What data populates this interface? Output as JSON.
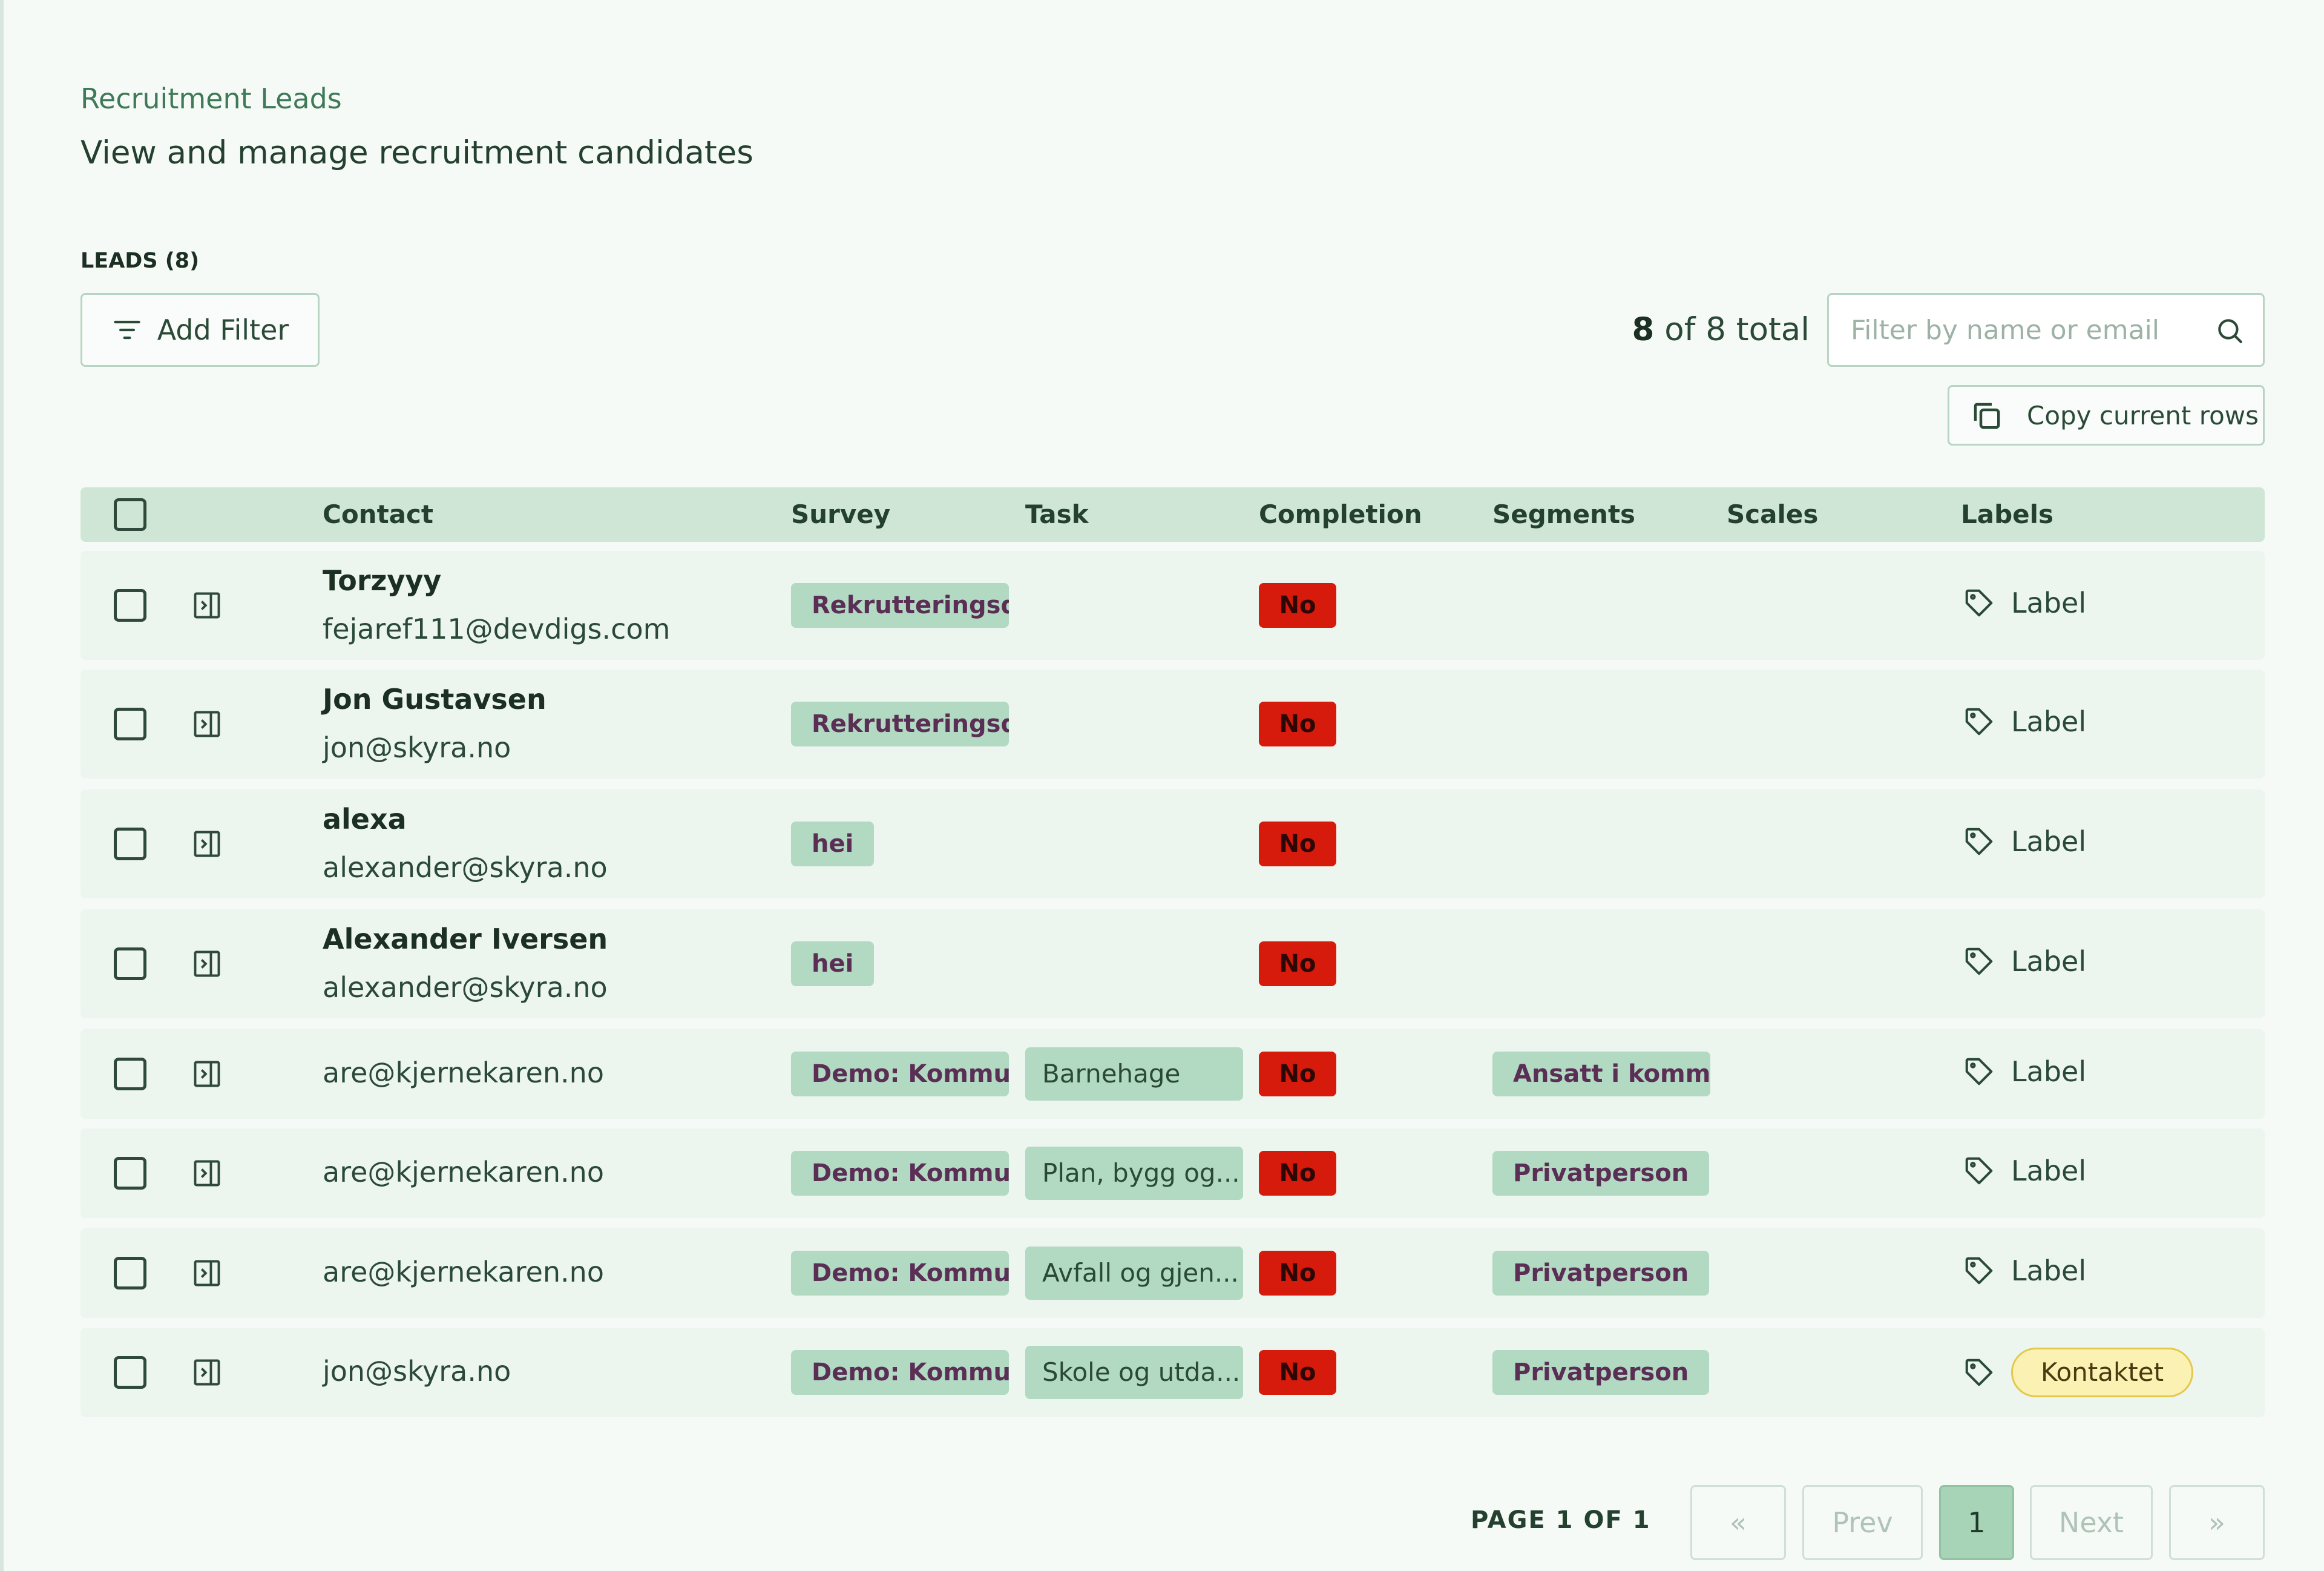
{
  "header": {
    "breadcrumb": "Recruitment Leads",
    "subtitle": "View and manage recruitment candidates"
  },
  "leads": {
    "heading": "LEADS (8)",
    "add_filter_label": "Add Filter",
    "total_count": "8",
    "total_suffix": "of 8 total",
    "search_placeholder": "Filter by name or email",
    "copy_label": "Copy current rows"
  },
  "table": {
    "columns": [
      "Contact",
      "Survey",
      "Task",
      "Completion",
      "Segments",
      "Scales",
      "Labels"
    ],
    "rows": [
      {
        "name": "Torzyyy",
        "email": "fejaref111@devdigs.com",
        "survey": "Rekrutteringsdesk",
        "task": "",
        "completion": "No",
        "segment": "",
        "label": "Label"
      },
      {
        "name": "Jon Gustavsen",
        "email": "jon@skyra.no",
        "survey": "Rekrutteringsdesk",
        "task": "",
        "completion": "No",
        "segment": "",
        "label": "Label"
      },
      {
        "name": "alexa",
        "email": "alexander@skyra.no",
        "survey": "hei",
        "task": "",
        "completion": "No",
        "segment": "",
        "label": "Label"
      },
      {
        "name": "Alexander Iversen",
        "email": "alexander@skyra.no",
        "survey": "hei",
        "task": "",
        "completion": "No",
        "segment": "",
        "label": "Label"
      },
      {
        "name": "",
        "email": "are@kjernekaren.no",
        "survey": "Demo: Kommune",
        "task": "Barnehage",
        "completion": "No",
        "segment": "Ansatt i kommune",
        "label": "Label"
      },
      {
        "name": "",
        "email": "are@kjernekaren.no",
        "survey": "Demo: Kommune",
        "task": "Plan, bygg og...",
        "completion": "No",
        "segment": "Privatperson",
        "label": "Label"
      },
      {
        "name": "",
        "email": "are@kjernekaren.no",
        "survey": "Demo: Kommune",
        "task": "Avfall og gjen...",
        "completion": "No",
        "segment": "Privatperson",
        "label": "Label"
      },
      {
        "name": "",
        "email": "jon@skyra.no",
        "survey": "Demo: Kommune",
        "task": "Skole og utda...",
        "completion": "No",
        "segment": "Privatperson",
        "label": "Kontaktet"
      }
    ]
  },
  "pagination": {
    "page_label": "PAGE 1 OF 1",
    "first": "«",
    "prev": "Prev",
    "current": "1",
    "next": "Next",
    "last": "»"
  },
  "colors": {
    "accent": "#a7d3b6",
    "header_bg": "#cfe6d6",
    "row_bg": "#edf5ef",
    "chip_bg": "#b2d9c1",
    "no_badge": "#d61a0c",
    "pill_bg": "#fbf1b3"
  },
  "icons": [
    "filter-icon",
    "search-icon",
    "copy-icon",
    "expand-panel-icon",
    "tag-icon"
  ]
}
